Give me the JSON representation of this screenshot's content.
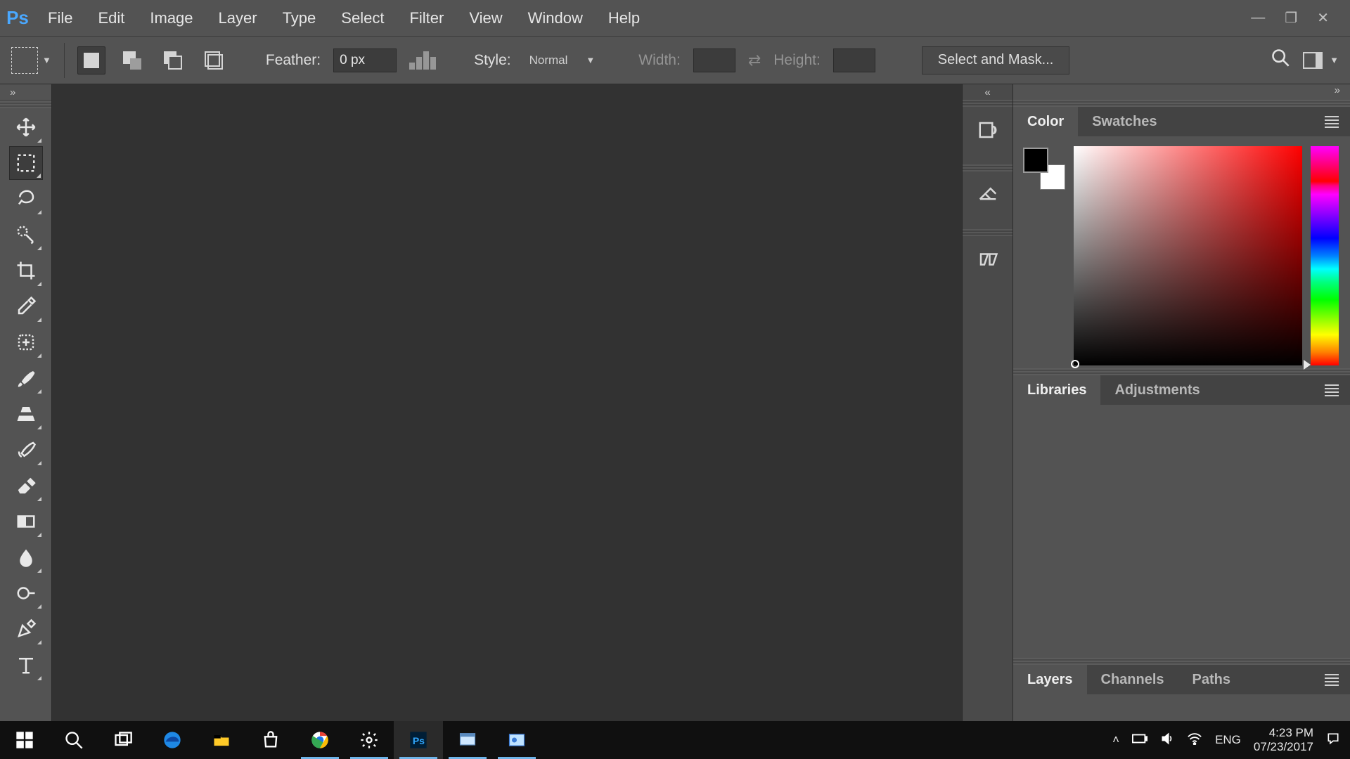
{
  "app": {
    "logo_text": "Ps"
  },
  "menu": {
    "file": "File",
    "edit": "Edit",
    "image": "Image",
    "layer": "Layer",
    "type": "Type",
    "select": "Select",
    "filter": "Filter",
    "view": "View",
    "window": "Window",
    "help": "Help"
  },
  "options": {
    "feather_label": "Feather:",
    "feather_value": "0 px",
    "style_label": "Style:",
    "style_value": "Normal",
    "width_label": "Width:",
    "width_value": "",
    "height_label": "Height:",
    "height_value": "",
    "select_mask": "Select and Mask..."
  },
  "panels": {
    "color": {
      "tab_color": "Color",
      "tab_swatches": "Swatches"
    },
    "lib": {
      "tab_lib": "Libraries",
      "tab_adj": "Adjustments"
    },
    "layers": {
      "tab_layers": "Layers",
      "tab_channels": "Channels",
      "tab_paths": "Paths"
    }
  },
  "taskbar": {
    "lang": "ENG",
    "time": "4:23 PM",
    "date": "07/23/2017"
  }
}
